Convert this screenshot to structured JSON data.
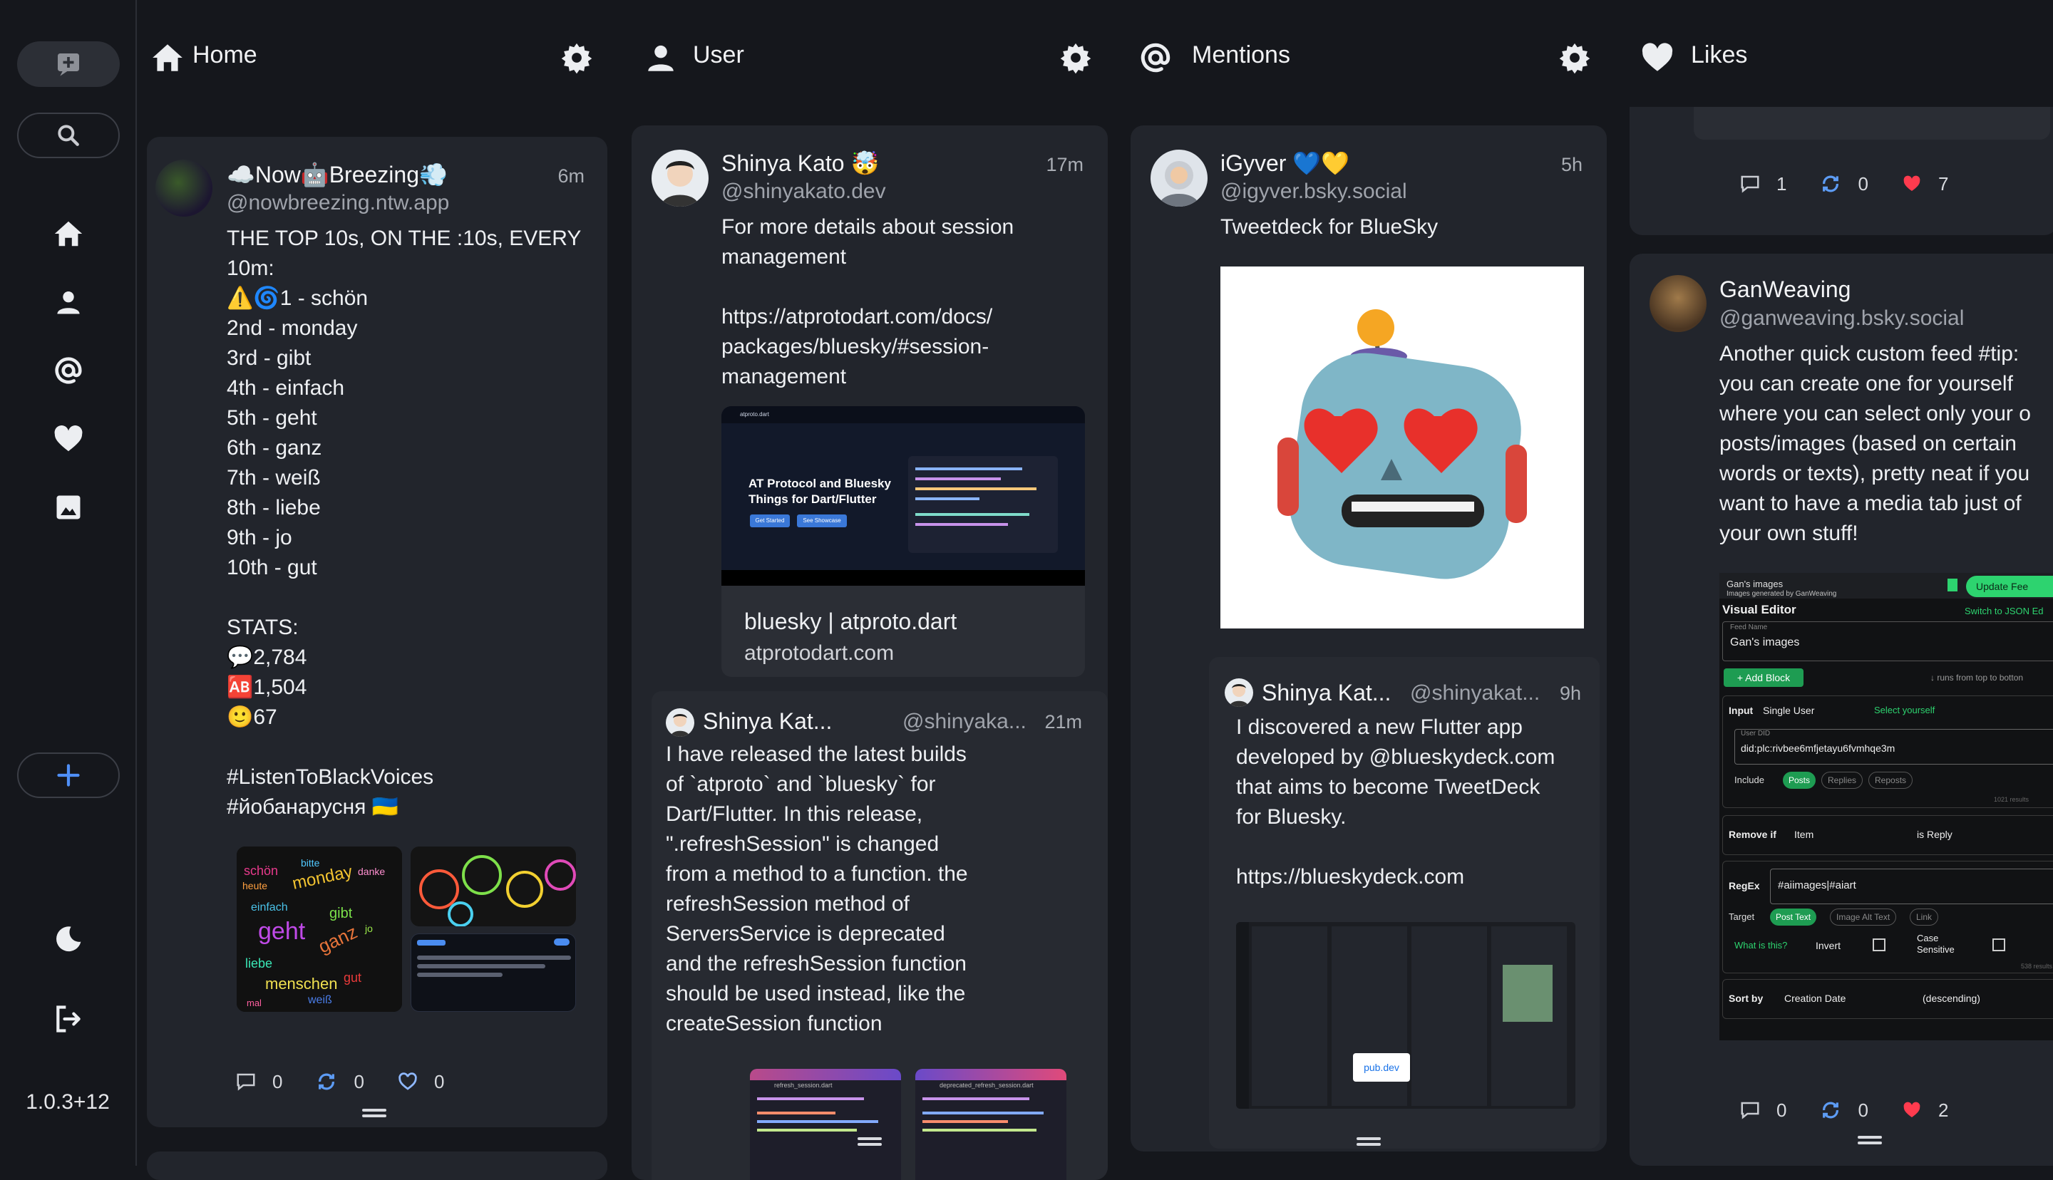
{
  "app": {
    "version": "1.0.3+12"
  },
  "sidebar": {
    "icons": [
      "compose-icon",
      "search-icon",
      "home-icon",
      "user-icon",
      "at-icon",
      "heart-icon",
      "image-icon",
      "add-icon",
      "moon-icon",
      "logout-icon"
    ]
  },
  "columns": [
    {
      "title": "Home",
      "icon": "home-icon"
    },
    {
      "title": "User",
      "icon": "user-icon"
    },
    {
      "title": "Mentions",
      "icon": "at-icon"
    },
    {
      "title": "Likes",
      "icon": "heart-icon"
    }
  ],
  "home_post": {
    "name": "☁️Now🤖Breezing💨",
    "handle": "@nowbreezing.ntw.app",
    "time": "6m",
    "body": "THE TOP 10s, ON THE :10s, EVERY\n10m:\n⚠️🌀1 - schön\n2nd - monday\n3rd - gibt\n4th - einfach\n5th - geht\n6th - ganz\n7th - weiß\n8th - liebe\n9th - jo\n10th - gut\n\nSTATS:\n💬2,784\n🆎1,504\n🙂67\n\n#ListenToBlackVoices\n#йобанарусня 🇺🇦",
    "replies": "0",
    "reposts": "0",
    "likes": "0",
    "wordcloud": [
      "schön",
      "monday",
      "einfach",
      "gibt",
      "geht",
      "ganz",
      "liebe",
      "gut",
      "menschen",
      "weiß",
      "danke",
      "jo",
      "heute",
      "bitte",
      "mal"
    ]
  },
  "user_post": {
    "name": "Shinya Kato 🤯",
    "handle": "@shinyakato.dev",
    "time": "17m",
    "body": "For more details about session\nmanagement\n\nhttps://atprotodart.com/docs/\npackages/bluesky/#session-\nmanagement",
    "card_title": "bluesky | atproto.dart",
    "card_domain": "atprotodart.com",
    "card_heading": "AT Protocol and Bluesky\nThings for Dart/Flutter",
    "card_btn1": "Get Started",
    "card_btn2": "See Showcase",
    "card_site": "atproto.dart"
  },
  "user_quote": {
    "name": "Shinya Kat...",
    "handle": "@shinyaka...",
    "time": "21m",
    "body": "I have released the latest builds\nof `atproto` and `bluesky` for\nDart/Flutter. In this release,\n\".refreshSession\" is changed\nfrom a method to a function. the\nrefreshSession method of\nServersService is deprecated\nand the refreshSession function\nshould be used instead, like the\ncreateSession function",
    "file1": "refresh_session.dart",
    "file2": "deprecated_refresh_session.dart"
  },
  "mention_post": {
    "name": "iGyver 💙💛",
    "handle": "@igyver.bsky.social",
    "time": "5h",
    "body": "Tweetdeck for BlueSky"
  },
  "mention_quote": {
    "name": "Shinya Kat...",
    "handle": "@shinyakat...",
    "time": "9h",
    "body": "I discovered a new Flutter app\ndeveloped by @blueskydeck.com\nthat aims to become TweetDeck\nfor Bluesky.\n\nhttps://blueskydeck.com",
    "pub": "pub.dev"
  },
  "likes_top": {
    "replies": "1",
    "reposts": "0",
    "likes": "7"
  },
  "likes_post": {
    "name": "GanWeaving",
    "handle": "@ganweaving.bsky.social",
    "body": "Another quick custom feed #tip:\nyou can create one for yourself\nwhere you can select only your o\nposts/images (based on certain\nwords or texts), pretty neat if you\nwant to have a media tab just of\nyour own stuff!",
    "replies": "0",
    "reposts": "0",
    "likes": "2",
    "editor": {
      "feed_title": "Gan's images",
      "feed_sub": "Images generated by GanWeaving",
      "update_btn": "Update Fee",
      "visual_editor": "Visual Editor",
      "switch_json": "Switch to JSON Ed",
      "feed_name_label": "Feed Name",
      "feed_name": "Gan's images",
      "add_block": "+ Add Block",
      "runs_hint": "↓ runs from top to botton",
      "input_label": "Input",
      "input_value": "Single User",
      "select_yourself": "Select yourself",
      "did_label": "User DID",
      "did_value": "did:plc:rivbee6mfjetayu6fvmhqe3m",
      "include_label": "Include",
      "chip_posts": "Posts",
      "chip_replies": "Replies",
      "chip_reposts": "Reposts",
      "remove_label": "Remove if",
      "remove_item": "Item",
      "remove_op": "is Reply",
      "regex_label": "RegEx",
      "regex_value": "#aiimages|#aiart",
      "target_label": "Target",
      "chip_post_text": "Post Text",
      "chip_alt": "Image Alt Text",
      "chip_link": "Link",
      "what_is": "What is this?",
      "invert": "Invert",
      "case": "Case\nSensitive",
      "sort_label": "Sort by",
      "sort_value": "Creation Date",
      "sort_dir": "(descending)",
      "results1": "1021 results",
      "results2": "538 results"
    }
  },
  "colors": {
    "bg": "#15171c",
    "card": "#22252c",
    "accent_green": "#2dd36f",
    "like_red": "#ff3b4e"
  }
}
